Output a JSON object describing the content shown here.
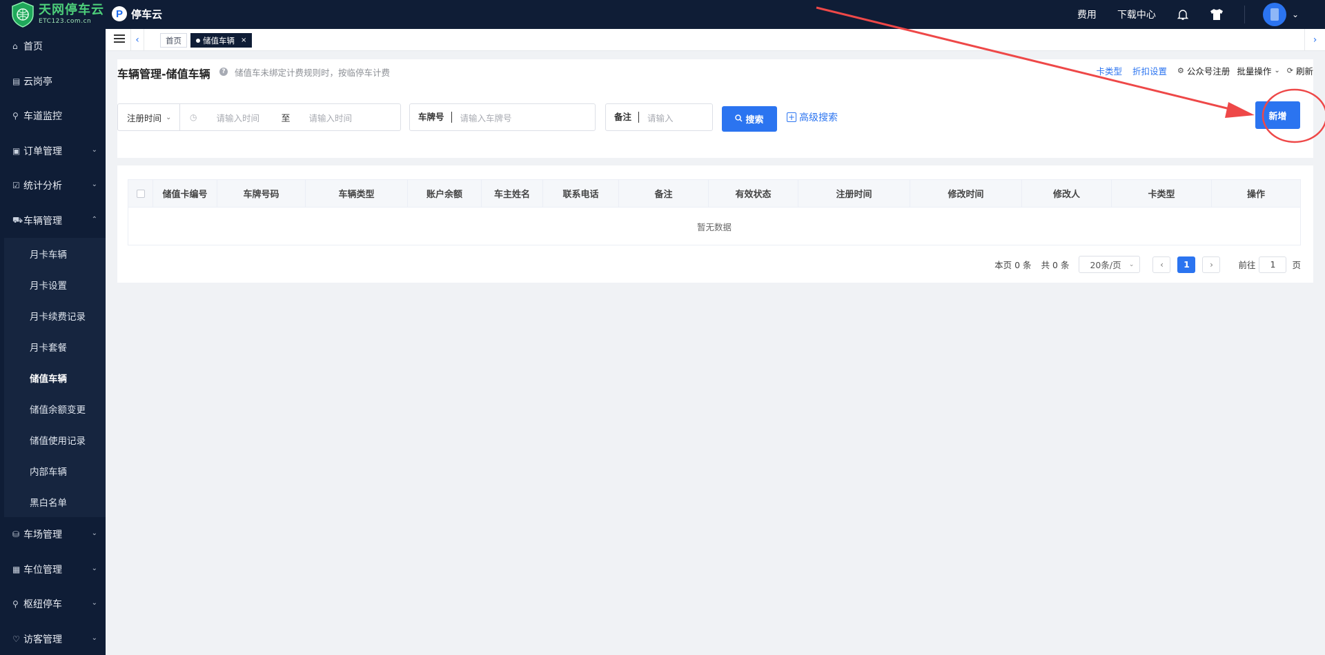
{
  "brand": {
    "name": "天网停车云",
    "domain": "ETC123.com.cn",
    "logo_color": "#4dcf7a"
  },
  "app": {
    "icon_letter": "P",
    "name": "停车云"
  },
  "topnav": {
    "fee": "费用",
    "download": "下载中心"
  },
  "sidebar": {
    "items": [
      {
        "label": "首页",
        "icon": "home-icon"
      },
      {
        "label": "云岗亭",
        "icon": "booth-icon"
      },
      {
        "label": "车道监控",
        "icon": "monitor-icon"
      },
      {
        "label": "订单管理",
        "icon": "order-icon"
      },
      {
        "label": "统计分析",
        "icon": "chart-icon"
      },
      {
        "label": "车辆管理",
        "icon": "car-icon"
      }
    ],
    "submenu": [
      "月卡车辆",
      "月卡设置",
      "月卡续费记录",
      "月卡套餐",
      "储值车辆",
      "储值余额变更",
      "储值使用记录",
      "内部车辆",
      "黑白名单"
    ],
    "bottom": [
      "车场管理",
      "车位管理",
      "枢纽停车",
      "访客管理"
    ]
  },
  "tabs": {
    "home": "首页",
    "active": "储值车辆",
    "close": "×"
  },
  "page": {
    "title": "车辆管理-储值车辆",
    "hint": "储值车未绑定计费规则时，按临停车计费",
    "actions": {
      "card_type": "卡类型",
      "discount": "折扣设置",
      "wechat": "公众号注册",
      "batch": "批量操作",
      "refresh": "刷新"
    }
  },
  "filters": {
    "date_select": "注册时间",
    "start_placeholder": "请输入时间",
    "to": "至",
    "end_placeholder": "请输入时间",
    "plate_label": "车牌号",
    "plate_placeholder": "请输入车牌号",
    "note_label": "备注",
    "note_placeholder": "请输入",
    "search": "搜索",
    "advanced": "高级搜索",
    "add": "新增"
  },
  "table": {
    "columns": [
      "储值卡编号",
      "车牌号码",
      "车辆类型",
      "账户余额",
      "车主姓名",
      "联系电话",
      "备注",
      "有效状态",
      "注册时间",
      "修改时间",
      "修改人",
      "卡类型",
      "操作"
    ],
    "empty": "暂无数据"
  },
  "pager": {
    "page_count": "本页 0 条",
    "total": "共 0 条",
    "size": "20条/页",
    "current": "1",
    "goto": "前往",
    "goto_value": "1",
    "page_unit": "页"
  },
  "colors": {
    "primary": "#2b74f0",
    "nav": "#0f1d36",
    "annotation": "#ee4848"
  }
}
